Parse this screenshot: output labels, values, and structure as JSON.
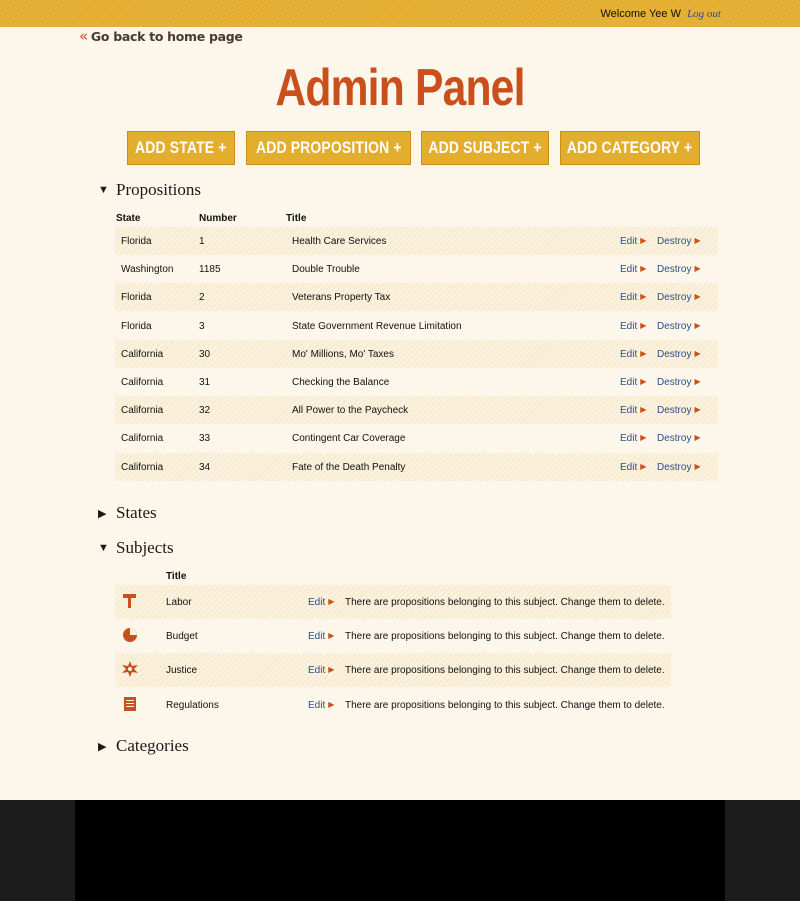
{
  "header": {
    "welcome_text": "Welcome",
    "user_name": "Yee W",
    "logout_label": "Log out"
  },
  "back_link": {
    "label": "Go back to home page"
  },
  "page_title": "Admin Panel",
  "add_buttons": [
    {
      "label": "ADD STATE +"
    },
    {
      "label": "ADD PROPOSITION +"
    },
    {
      "label": "ADD SUBJECT +"
    },
    {
      "label": "ADD CATEGORY +"
    }
  ],
  "propositions": {
    "heading": "Propositions",
    "expanded": true,
    "columns": {
      "state": "State",
      "number": "Number",
      "title": "Title"
    },
    "edit_label": "Edit",
    "destroy_label": "Destroy",
    "rows": [
      {
        "state": "Florida",
        "number": "1",
        "title": "Health Care Services"
      },
      {
        "state": "Washington",
        "number": "1185",
        "title": "Double Trouble"
      },
      {
        "state": "Florida",
        "number": "2",
        "title": "Veterans Property Tax"
      },
      {
        "state": "Florida",
        "number": "3",
        "title": "State Government Revenue Limitation"
      },
      {
        "state": "California",
        "number": "30",
        "title": "Mo' Millions, Mo' Taxes"
      },
      {
        "state": "California",
        "number": "31",
        "title": "Checking the Balance"
      },
      {
        "state": "California",
        "number": "32",
        "title": "All Power to the Paycheck"
      },
      {
        "state": "California",
        "number": "33",
        "title": "Contingent Car Coverage"
      },
      {
        "state": "California",
        "number": "34",
        "title": "Fate of the Death Penalty"
      }
    ]
  },
  "states": {
    "heading": "States",
    "expanded": false
  },
  "subjects": {
    "heading": "Subjects",
    "expanded": true,
    "columns": {
      "title": "Title"
    },
    "edit_label": "Edit",
    "rows": [
      {
        "icon": "hammer-icon",
        "title": "Labor",
        "note": "There are propositions belonging to this subject. Change them to delete."
      },
      {
        "icon": "pie-chart-icon",
        "title": "Budget",
        "note": "There are propositions belonging to this subject. Change them to delete."
      },
      {
        "icon": "sheriff-star-icon",
        "title": "Justice",
        "note": "There are propositions belonging to this subject. Change them to delete."
      },
      {
        "icon": "document-icon",
        "title": "Regulations",
        "note": "There are propositions belonging to this subject. Change them to delete."
      }
    ]
  },
  "categories": {
    "heading": "Categories",
    "expanded": false
  },
  "colors": {
    "accent_orange": "#c9501c",
    "button_gold": "#e3ad2e",
    "link_blue": "#2c4f86",
    "background": "#fcf7ea",
    "footer": "#000000"
  }
}
